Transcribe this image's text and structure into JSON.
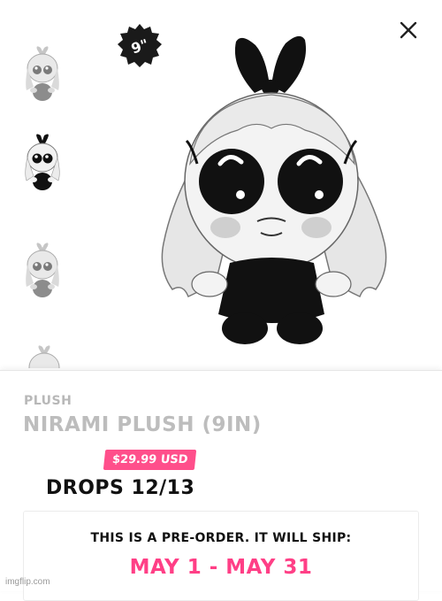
{
  "gallery": {
    "size_badge": "9\"",
    "close_icon": "close-icon",
    "thumbnails": [
      {
        "variant": "gray"
      },
      {
        "variant": "black"
      },
      {
        "variant": "gray"
      },
      {
        "variant": "gray-partial"
      }
    ]
  },
  "product": {
    "category": "PLUSH",
    "title": "NIRAMI PLUSH (9IN)",
    "price": "$29.99 USD",
    "drops": "DROPS 12/13",
    "preorder_note": "THIS IS A PRE-ORDER. IT WILL SHIP:",
    "ship_window": "MAY 1 - MAY 31"
  },
  "watermark": "imgflip.com",
  "colors": {
    "accent": "#ff4f8b",
    "ship_text": "#ff3f86",
    "muted_text": "#bdbdbd"
  }
}
